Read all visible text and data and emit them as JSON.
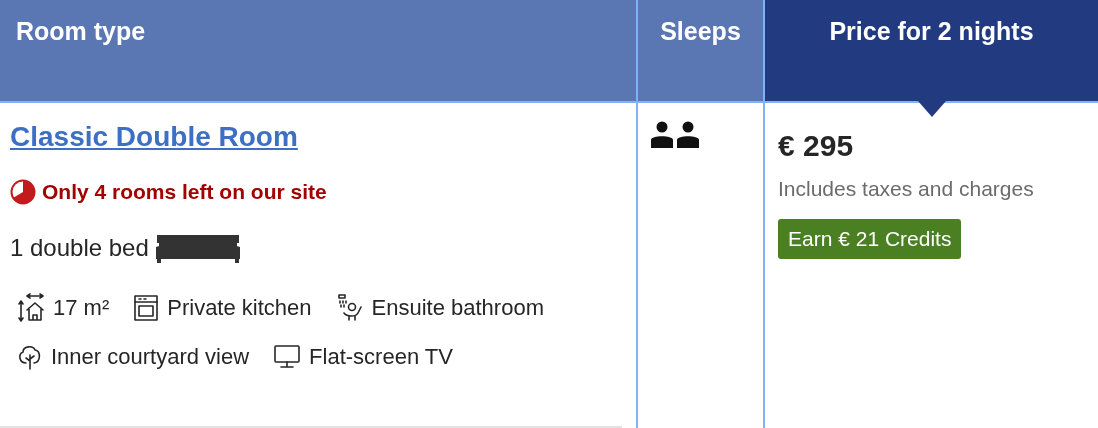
{
  "columns": [
    {
      "label": "Room type",
      "highlighted": false
    },
    {
      "label": "Sleeps",
      "highlighted": false
    },
    {
      "label": "Price for 2 nights",
      "highlighted": true
    }
  ],
  "room": {
    "name": "Classic Double Room",
    "scarcity": "Only 4 rooms left on our site",
    "bed": "1 double bed",
    "features": [
      {
        "kind": "area",
        "label": "17 m²"
      },
      {
        "kind": "kitchen",
        "label": "Private kitchen"
      },
      {
        "kind": "bathroom",
        "label": "Ensuite bathroom"
      },
      {
        "kind": "view",
        "label": "Inner courtyard view"
      },
      {
        "kind": "tv",
        "label": "Flat-screen TV"
      }
    ]
  },
  "price": {
    "amount": "€ 295",
    "note": "Includes taxes and charges",
    "credits": "Earn € 21 Credits"
  }
}
